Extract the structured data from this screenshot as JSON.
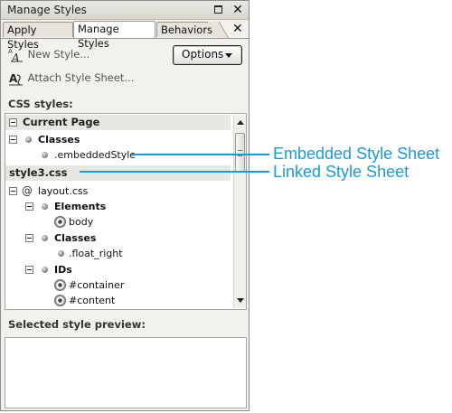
{
  "window": {
    "title": "Manage Styles",
    "restore_icon": "restore-window-icon",
    "close_icon": "close-icon"
  },
  "tabs": [
    {
      "label": "Apply Styles",
      "active": false
    },
    {
      "label": "Manage Styles",
      "active": true
    },
    {
      "label": "Behaviors",
      "active": false
    }
  ],
  "tab_close": "✕",
  "actions": {
    "new_style": "New Style...",
    "attach_style_sheet": "Attach Style Sheet...",
    "options_label": "Options"
  },
  "css_styles_label": "CSS styles:",
  "tree": {
    "current_page": "Current Page",
    "classes_1": "Classes",
    "embedded_style": ".embeddedStyle",
    "style3": "style3.css",
    "layout": "layout.css",
    "elements": "Elements",
    "body": "body",
    "classes_2": "Classes",
    "float_right": ".float_right",
    "ids": "IDs",
    "container": "#container",
    "content": "#content"
  },
  "preview_label": "Selected style preview:",
  "callouts": {
    "embedded": "Embedded Style Sheet",
    "linked": "Linked Style Sheet",
    "color": "#1a9bd7"
  }
}
